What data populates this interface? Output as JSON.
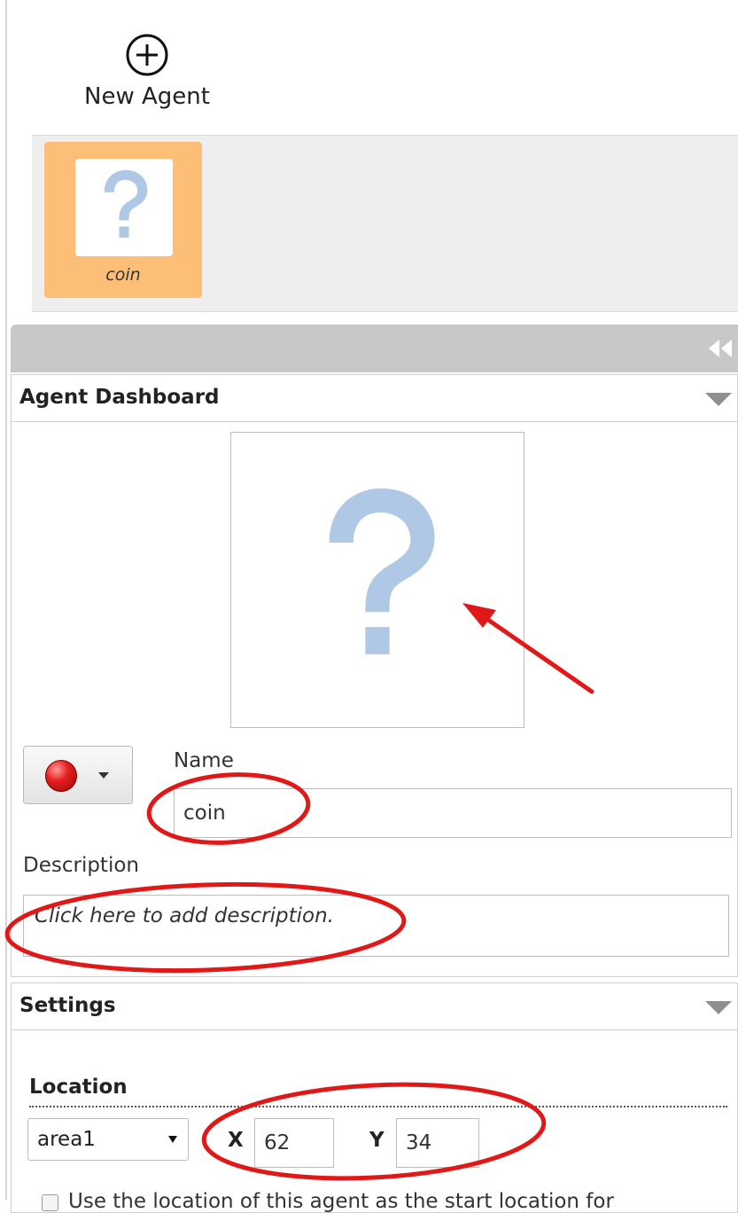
{
  "toolbar": {
    "new_agent_label": "New Agent",
    "new_agent_icon": "plus-circle-icon"
  },
  "agents": [
    {
      "name": "coin",
      "icon": "question-mark-icon",
      "tile_color": "#fdbf78"
    }
  ],
  "dashboard": {
    "title": "Agent Dashboard",
    "name_label": "Name",
    "name_value": "coin",
    "description_label": "Description",
    "description_placeholder": "Click here to add description.",
    "color_picker_icon": "red-ball-icon"
  },
  "settings": {
    "title": "Settings",
    "location_title": "Location",
    "area_value": "area1",
    "x_label": "X",
    "x_value": "62",
    "y_label": "Y",
    "y_value": "34",
    "start_location_text": "Use the location of this agent as the start location for"
  },
  "annotation_color": "#e01818",
  "question_color": "#aec8e6"
}
